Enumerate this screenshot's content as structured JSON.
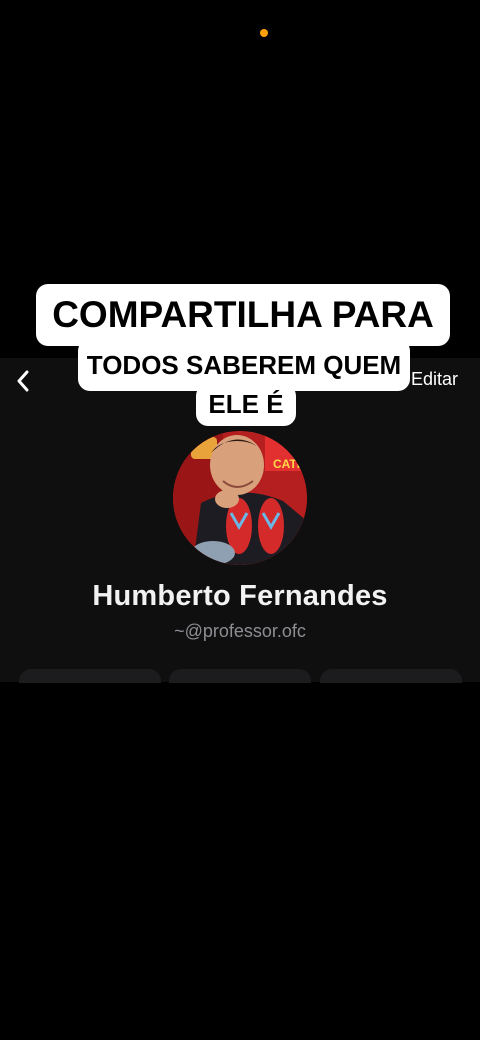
{
  "status_bar": {
    "indicator_color": "#ff9f0a"
  },
  "header": {
    "back_icon": "chevron-left-icon",
    "edit_label": "Editar"
  },
  "profile": {
    "name": "Humberto Fernandes",
    "handle": "~@professor.ofc",
    "avatar_banner_text": "CATI"
  },
  "overlay_caption": {
    "line1": "COMPARTILHA PARA",
    "line2": "TODOS SABEREM QUEM",
    "line3": "ELE É"
  },
  "colors": {
    "background": "#000000",
    "panel": "#0f0f0f",
    "name_text": "#f2f2f2",
    "handle_text": "#8d8d93",
    "caption_bg": "#ffffff"
  }
}
